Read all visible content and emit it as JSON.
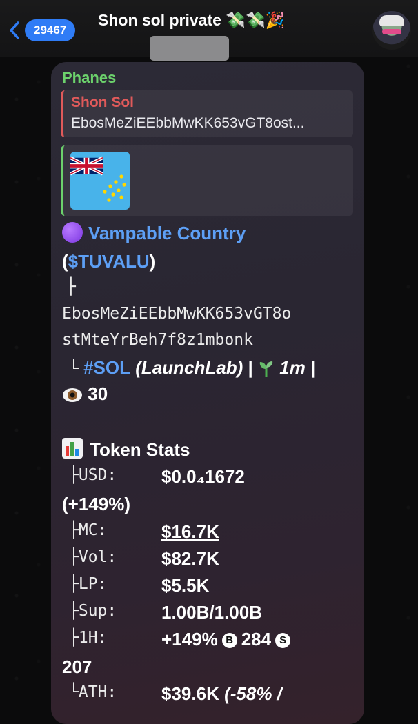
{
  "header": {
    "back_count": "29467",
    "title": "Shon sol private 💸💸🎉"
  },
  "message": {
    "sender": "Phanes",
    "reply": {
      "name": "Shon Sol",
      "text": "EbosMeZiEEbbMwKK653vGT8ost..."
    },
    "token": {
      "name": "Vampable Country",
      "open_paren": "(",
      "ticker": "$TUVALU",
      "close_paren": ")",
      "tree_top": "├",
      "address_line1": "EbosMeZiEEbbMwKK653vGT8o",
      "address_line2": "stMteYrBeh7f8z1mbonk",
      "tree_end": "└",
      "chain_tag": "#SOL",
      "launchpad": "(LaunchLab)",
      "sep1": "|",
      "age": "1m",
      "sep2": "|",
      "views": "30"
    },
    "stats": {
      "heading": "Token Stats",
      "usd_label": "├USD:",
      "usd_value": "$0.0₄1672",
      "usd_change": "(+149%)",
      "mc_label": "├MC:",
      "mc_value": "$16.7K",
      "vol_label": "├Vol:",
      "vol_value": "$82.7K",
      "lp_label": "├LP:",
      "lp_value": "$5.5K",
      "sup_label": "├Sup:",
      "sup_value": "1.00B/1.00B",
      "h1_label": "├1H:",
      "h1_value": "+149%",
      "h1_buys": "284",
      "h1_sells": "207",
      "ath_label": "└ATH:",
      "ath_value": "$39.6K",
      "ath_change": "(-58% /"
    }
  },
  "icons": {
    "back": "chevron-left-icon",
    "buy_badge": "B",
    "sell_badge": "S"
  },
  "colors": {
    "accent": "#2f7cf6",
    "sender": "#6cd16c",
    "reply_bar": "#e05a5a",
    "link": "#5d9ff5"
  }
}
